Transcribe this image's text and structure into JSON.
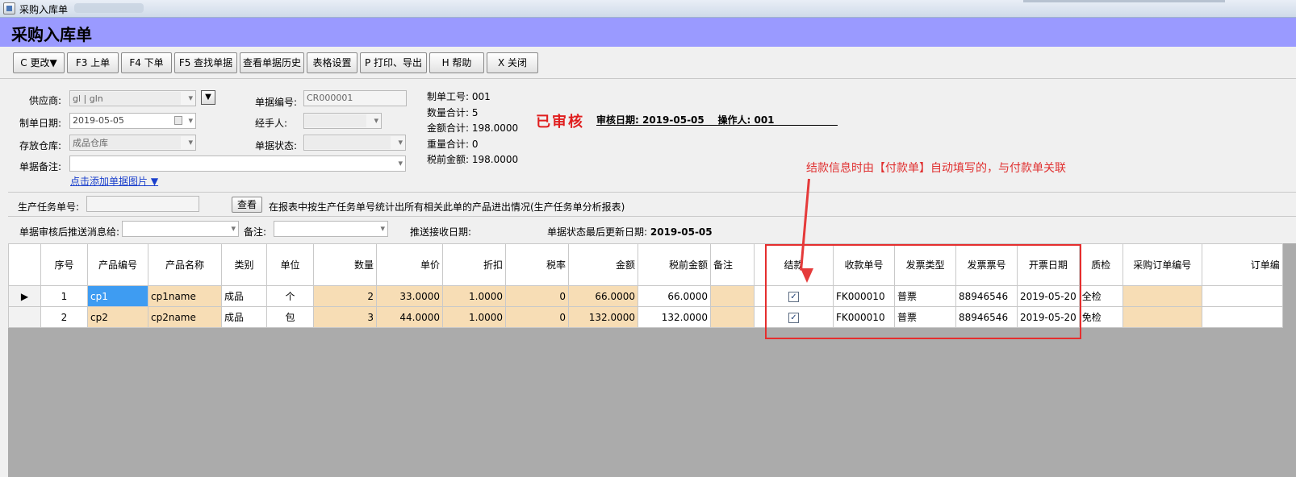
{
  "window": {
    "title": "采购入库单"
  },
  "header": {
    "title": "采购入库单"
  },
  "toolbar": {
    "buttons": [
      "C 更改▼",
      "F3 上单",
      "F4 下单",
      "F5 查找单据",
      "查看单据历史",
      "表格设置",
      "P 打印、导出",
      "H 帮助",
      "X 关闭"
    ]
  },
  "form": {
    "supplier_label": "供应商:",
    "supplier_value": "gl | gln",
    "date_label": "制单日期:",
    "date_value": "2019-05-05",
    "warehouse_label": "存放仓库:",
    "warehouse_value": "成品仓库",
    "remark_label": "单据备注:",
    "remark_value": "",
    "add_image_link": "点击添加单据图片 ▼",
    "docno_label": "单据编号:",
    "docno_value": "CR000001",
    "handler_label": "经手人:",
    "handler_value": "",
    "status_label": "单据状态:",
    "status_value": ""
  },
  "summary": {
    "maker_label": "制单工号:",
    "maker_value": "001",
    "qty_label": "数量合计:",
    "qty_value": "5",
    "amount_label": "金额合计:",
    "amount_value": "198.0000",
    "weight_label": "重量合计:",
    "weight_value": "0",
    "pretax_label": "税前金额:",
    "pretax_value": "198.0000"
  },
  "audit": {
    "stamp": "已审核",
    "date_label": "审核日期:",
    "date_value": "2019-05-05",
    "operator_label": "操作人:",
    "operator_value": "001"
  },
  "annotation": {
    "text": "结款信息时由【付款单】自动填写的，与付款单关联"
  },
  "task": {
    "label": "生产任务单号:",
    "value": "",
    "button": "查看",
    "desc": "在报表中按生产任务单号统计出所有相关此单的产品进出情况(生产任务单分析报表)"
  },
  "push": {
    "label": "单据审核后推送消息给:",
    "value": "",
    "remark_label": "备注:",
    "remark_value": "",
    "recv_date_label": "推送接收日期:",
    "updated_label": "单据状态最后更新日期:",
    "updated_value": "2019-05-05"
  },
  "grid": {
    "columns": [
      "序号",
      "产品编号",
      "产品名称",
      "类别",
      "单位",
      "数量",
      "单价",
      "折扣",
      "税率",
      "金额",
      "税前金额",
      "备注",
      "结款",
      "收款单号",
      "发票类型",
      "发票票号",
      "开票日期",
      "质检",
      "采购订单编号",
      "订单编"
    ],
    "rows": [
      {
        "cells": [
          "1",
          "cp1",
          "cp1name",
          "成品",
          "个",
          "2",
          "33.0000",
          "1.0000",
          "0",
          "66.0000",
          "66.0000",
          "",
          "✓",
          "FK000010",
          "普票",
          "88946546",
          "2019-05-20",
          "全检",
          "",
          ""
        ]
      },
      {
        "cells": [
          "2",
          "cp2",
          "cp2name",
          "成品",
          "包",
          "3",
          "44.0000",
          "1.0000",
          "0",
          "132.0000",
          "132.0000",
          "",
          "✓",
          "FK000010",
          "普票",
          "88946546",
          "2019-05-20",
          "免检",
          "",
          ""
        ]
      }
    ]
  },
  "colors": {
    "header_band": "#9a9aff",
    "highlight": "#e52e2e",
    "peach_cell": "#f7ddb5",
    "selected_cell": "#3e9cf2"
  }
}
